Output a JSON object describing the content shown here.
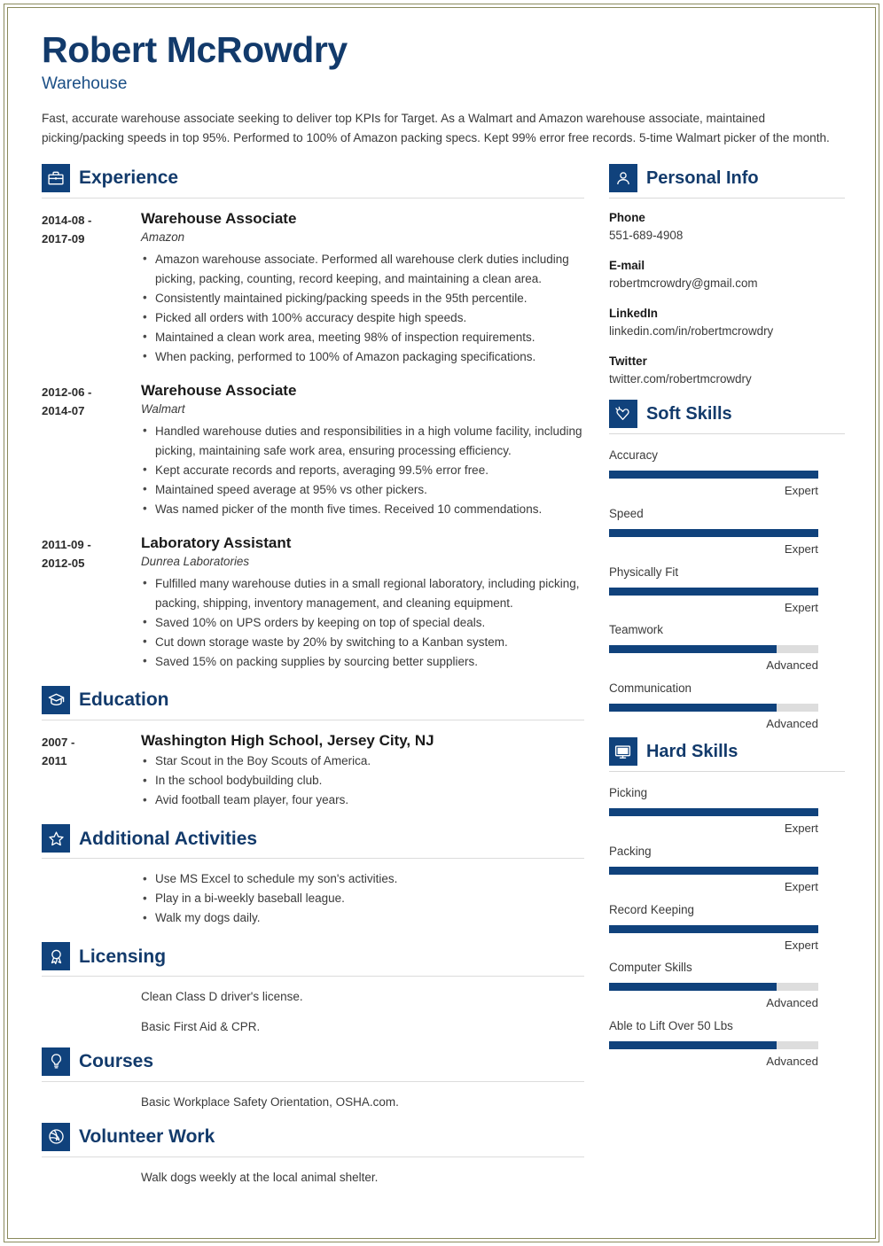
{
  "colors": {
    "brand_dark": "#10427c",
    "heading_blue": "#123a6b",
    "subtitle_blue": "#1b4f86",
    "bar_filled": "#10427c",
    "bar_empty": "#dddddd",
    "page_border": "#8a8a5c"
  },
  "header": {
    "name": "Robert McRowdry",
    "job_title": "Warehouse",
    "summary": "Fast, accurate warehouse associate seeking to deliver top KPIs for Target. As a Walmart and Amazon warehouse associate, maintained picking/packing speeds in top 95%. Performed to 100% of Amazon packing specs. Kept 99% error free records. 5-time Walmart picker of the month."
  },
  "main": {
    "experience": {
      "title": "Experience",
      "icon": "briefcase-icon",
      "entries": [
        {
          "date": "2014-08 - 2017-09",
          "date_from": "2014-08 -",
          "date_to": "2017-09",
          "role": "Warehouse Associate",
          "org": "Amazon",
          "bullets": [
            "Amazon warehouse associate. Performed all warehouse clerk duties including picking, packing, counting, record keeping, and maintaining a clean area.",
            "Consistently maintained picking/packing speeds in the 95th percentile.",
            "Picked all orders with 100% accuracy despite high speeds.",
            "Maintained a clean work area, meeting 98% of inspection requirements.",
            "When packing, performed to 100% of Amazon packaging specifications."
          ]
        },
        {
          "date": "2012-06 - 2014-07",
          "date_from": "2012-06 -",
          "date_to": "2014-07",
          "role": "Warehouse Associate",
          "org": "Walmart",
          "bullets": [
            "Handled warehouse duties and responsibilities in a high volume facility, including picking, maintaining safe work area, ensuring processing efficiency.",
            "Kept accurate records and reports, averaging 99.5% error free.",
            "Maintained speed average at 95% vs other pickers.",
            "Was named picker of the month five times. Received 10 commendations."
          ]
        },
        {
          "date": "2011-09 - 2012-05",
          "date_from": "2011-09 -",
          "date_to": "2012-05",
          "role": "Laboratory Assistant",
          "org": "Dunrea Laboratories",
          "bullets": [
            "Fulfilled many warehouse duties in a small regional laboratory, including picking, packing, shipping, inventory management, and cleaning equipment.",
            "Saved 10% on UPS orders by keeping on top of special deals.",
            "Cut down storage waste by 20% by switching to a Kanban system.",
            "Saved 15% on packing supplies by sourcing better suppliers."
          ]
        }
      ]
    },
    "education": {
      "title": "Education",
      "icon": "graduation-cap-icon",
      "entries": [
        {
          "date_from": "2007 -",
          "date_to": "2011",
          "school": "Washington High School, Jersey City, NJ",
          "bullets": [
            "Star Scout in the Boy Scouts of America.",
            "In the school bodybuilding club.",
            "Avid football team player, four years."
          ]
        }
      ]
    },
    "additional_activities": {
      "title": "Additional Activities",
      "icon": "star-icon",
      "bullets": [
        "Use MS Excel to schedule my son's activities.",
        "Play in a bi-weekly baseball league.",
        "Walk my dogs daily."
      ]
    },
    "licensing": {
      "title": "Licensing",
      "icon": "award-ribbon-icon",
      "lines": [
        "Clean Class D driver's license.",
        "Basic First Aid & CPR."
      ]
    },
    "courses": {
      "title": "Courses",
      "icon": "lightbulb-icon",
      "lines": [
        "Basic Workplace Safety Orientation, OSHA.com."
      ]
    },
    "volunteer_work": {
      "title": "Volunteer Work",
      "icon": "globe-icon",
      "lines": [
        "Walk dogs weekly at the local animal shelter."
      ]
    }
  },
  "sidebar": {
    "personal_info": {
      "title": "Personal Info",
      "icon": "person-icon",
      "fields": [
        {
          "label": "Phone",
          "value": "551-689-4908"
        },
        {
          "label": "E-mail",
          "value": "robertmcrowdry@gmail.com"
        },
        {
          "label": "LinkedIn",
          "value": "linkedin.com/in/robertmcrowdry"
        },
        {
          "label": "Twitter",
          "value": "twitter.com/robertmcrowdry"
        }
      ]
    },
    "soft_skills": {
      "title": "Soft Skills",
      "icon": "heart-hand-icon",
      "skills": [
        {
          "name": "Accuracy",
          "level": "Expert",
          "percent": 100
        },
        {
          "name": "Speed",
          "level": "Expert",
          "percent": 100
        },
        {
          "name": "Physically Fit",
          "level": "Expert",
          "percent": 100
        },
        {
          "name": "Teamwork",
          "level": "Advanced",
          "percent": 80
        },
        {
          "name": "Communication",
          "level": "Advanced",
          "percent": 80
        }
      ]
    },
    "hard_skills": {
      "title": "Hard Skills",
      "icon": "monitor-icon",
      "skills": [
        {
          "name": "Picking",
          "level": "Expert",
          "percent": 100
        },
        {
          "name": "Packing",
          "level": "Expert",
          "percent": 100
        },
        {
          "name": "Record Keeping",
          "level": "Expert",
          "percent": 100
        },
        {
          "name": "Computer Skills",
          "level": "Advanced",
          "percent": 80
        },
        {
          "name": "Able to Lift Over 50 Lbs",
          "level": "Advanced",
          "percent": 80
        }
      ]
    }
  }
}
